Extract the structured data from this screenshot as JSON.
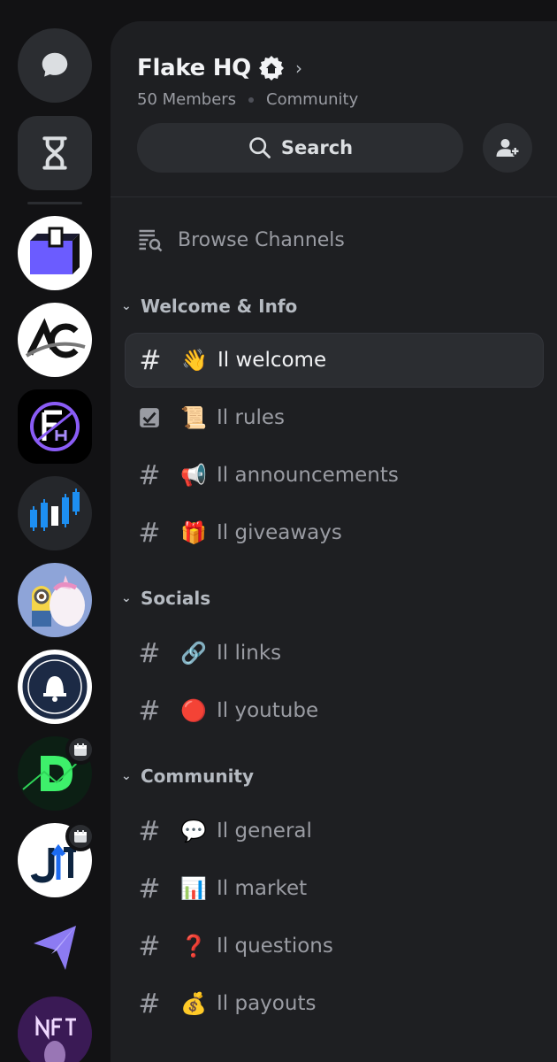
{
  "server": {
    "name": "Flake HQ",
    "members": "50 Members",
    "type": "Community"
  },
  "search": {
    "label": "Search"
  },
  "browse": {
    "label": "Browse Channels"
  },
  "categories": [
    {
      "name": "Welcome & Info",
      "channels": [
        {
          "icon": "hash-icon",
          "emoji": "👋",
          "name": "Il welcome",
          "active": true
        },
        {
          "icon": "rules-icon",
          "emoji": "📜",
          "name": "Il rules"
        },
        {
          "icon": "hash-icon",
          "emoji": "📢",
          "name": "Il announcements"
        },
        {
          "icon": "hash-icon",
          "emoji": "🎁",
          "name": "Il giveaways"
        }
      ]
    },
    {
      "name": "Socials",
      "channels": [
        {
          "icon": "hash-icon",
          "emoji": "🔗",
          "name": "Il links"
        },
        {
          "icon": "hash-icon",
          "emoji": "🔴",
          "name": "Il youtube"
        }
      ]
    },
    {
      "name": "Community",
      "channels": [
        {
          "icon": "hash-icon",
          "emoji": "💬",
          "name": "Il general"
        },
        {
          "icon": "hash-icon",
          "emoji": "📊",
          "name": "Il market"
        },
        {
          "icon": "hash-icon",
          "emoji": "❓",
          "name": "Il questions"
        },
        {
          "icon": "hash-icon",
          "emoji": "💰",
          "name": "Il payouts"
        }
      ]
    }
  ],
  "colors": {
    "background": "#121214",
    "panel": "#1e1f22",
    "surface": "#2b2d31",
    "text_muted": "#9a9ca3",
    "text_bright": "#f2f3f5"
  }
}
